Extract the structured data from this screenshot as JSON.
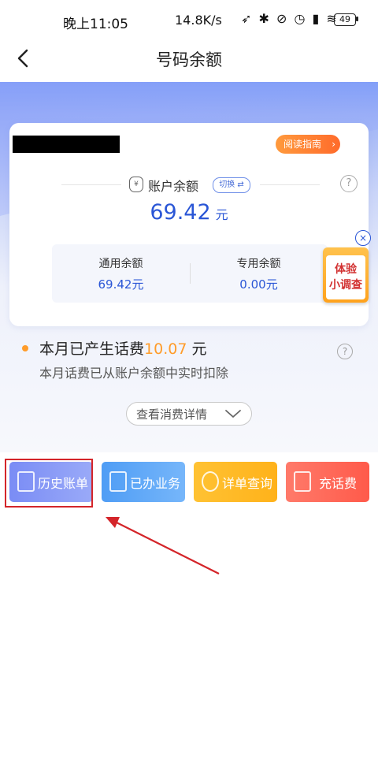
{
  "status_bar": {
    "time": "晚上11:05",
    "network_speed": "14.8K/s",
    "icons_text": "➶ ✱ ⊘ ◷ ▮ ≋",
    "battery": "49"
  },
  "nav": {
    "title": "号码余额"
  },
  "card": {
    "guide_label": "阅读指南",
    "guide_chevron": "›",
    "balance_label": "账户余额",
    "switch_label": "切换 ⇄",
    "money_icon_glyph": "¥",
    "help_glyph": "?",
    "balance_value": "69.42",
    "balance_unit": "元",
    "general_label": "通用余额",
    "general_value": "69.42元",
    "special_label": "专用余额",
    "special_value": "0.00元"
  },
  "survey": {
    "line1": "体验",
    "line2": "小调查",
    "close_glyph": "×"
  },
  "usage": {
    "title_prefix": "本月已产生话费",
    "amount": "10.07",
    "unit": " 元",
    "note": "本月话费已从账户余额中实时扣除",
    "details_label": "查看消费详情",
    "help_glyph": "?"
  },
  "actions": {
    "history": "历史账单",
    "business": "已办业务",
    "detail_query": "详单查询",
    "recharge": "充话费"
  },
  "colors": {
    "accent_blue": "#2a56d6",
    "accent_orange": "#ff9c2a",
    "annotation_red": "#d4252a"
  }
}
